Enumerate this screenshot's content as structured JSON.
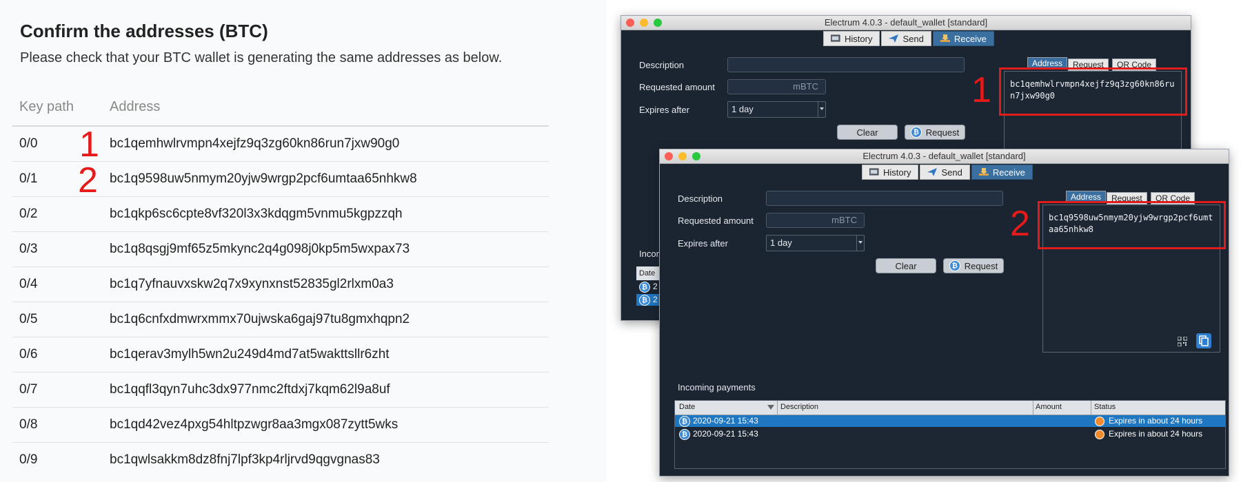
{
  "left": {
    "title": "Confirm the addresses (BTC)",
    "subtitle": "Please check that your BTC wallet is generating the same addresses as below.",
    "columns": [
      "Key path",
      "Address"
    ],
    "rows": [
      {
        "path": "0/0",
        "address": "bc1qemhwlrvmpn4xejfz9q3zg60kn86run7jxw90g0"
      },
      {
        "path": "0/1",
        "address": "bc1q9598uw5nmym20yjw9wrgp2pcf6umtaa65nhkw8"
      },
      {
        "path": "0/2",
        "address": "bc1qkp6sc6cpte8vf320l3x3kdqgm5vnmu5kgpzzqh"
      },
      {
        "path": "0/3",
        "address": "bc1q8qsgj9mf65z5mkync2q4g098j0kp5m5wxpax73"
      },
      {
        "path": "0/4",
        "address": "bc1q7yfnauvxskw2q7x9xynxnst52835gl2rlxm0a3"
      },
      {
        "path": "0/5",
        "address": "bc1q6cnfxdmwrxmmx70ujwska6gaj97tu8gmxhqpn2"
      },
      {
        "path": "0/6",
        "address": "bc1qerav3mylh5wn2u249d4md7at5wakttsllr6zht"
      },
      {
        "path": "0/7",
        "address": "bc1qqfl3qyn7uhc3dx977nmc2ftdxj7kqm62l9a8uf"
      },
      {
        "path": "0/8",
        "address": "bc1qd42vez4pxg54hltpzwgr8aa3mgx087zytt5wks"
      },
      {
        "path": "0/9",
        "address": "bc1qwlsakkm8dz8fnj7lpf3kp4rljrvd9qgvgnas83"
      }
    ],
    "markers": [
      "1",
      "2"
    ]
  },
  "window1": {
    "title": "Electrum 4.0.3  -  default_wallet  [standard]",
    "tabs": [
      "History",
      "Send",
      "Receive"
    ],
    "labels": {
      "description": "Description",
      "amount": "Requested amount",
      "expires": "Expires after"
    },
    "unit": "mBTC",
    "expires_value": "1 day",
    "clear": "Clear",
    "request": "Request",
    "subtabs": [
      "Address",
      "Request",
      "QR Code"
    ],
    "address": "bc1qemhwlrvmpn4xejfz9q3zg60kn86run7jxw90g0",
    "marker": "1",
    "incoming_partial": "Incom",
    "date_partial": "Date",
    "row_partial": [
      "2",
      "2"
    ]
  },
  "window2": {
    "title": "Electrum 4.0.3  -  default_wallet  [standard]",
    "tabs": [
      "History",
      "Send",
      "Receive"
    ],
    "labels": {
      "description": "Description",
      "amount": "Requested amount",
      "expires": "Expires after"
    },
    "unit": "mBTC",
    "expires_value": "1 day",
    "clear": "Clear",
    "request": "Request",
    "subtabs": [
      "Address",
      "Request",
      "QR Code"
    ],
    "address": "bc1q9598uw5nmym20yjw9wrgp2pcf6umtaa65nhkw8",
    "marker": "2",
    "incoming_label": "Incoming payments",
    "columns": [
      "Date",
      "Description",
      "Amount",
      "Status"
    ],
    "rows": [
      {
        "date": "2020-09-21 15:43",
        "status": "Expires in about 24 hours"
      },
      {
        "date": "2020-09-21 15:43",
        "status": "Expires in about 24 hours"
      }
    ]
  }
}
